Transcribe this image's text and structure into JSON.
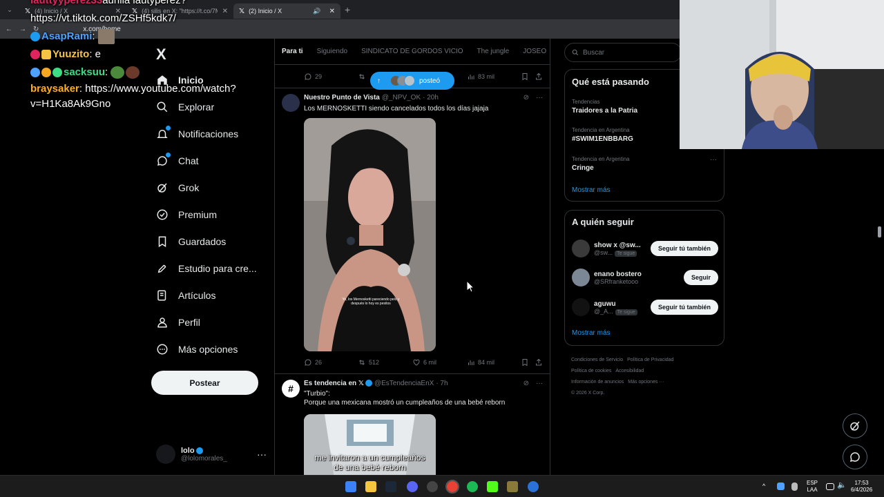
{
  "browser": {
    "tabs": [
      {
        "label": "(4) Inicio / X"
      },
      {
        "label": "(4) silis en X: \"https://t.co/7Mp"
      },
      {
        "label": "(2) Inicio / X"
      }
    ],
    "url": "x.com/home"
  },
  "chat": {
    "lines": [
      {
        "user": "lauttyyperez33",
        "text": "aurilla lautyperez?"
      },
      {
        "user": "",
        "text": "https://vt.tiktok.com/ZSHf5kdk7/"
      },
      {
        "user": "AsapRami",
        "text": ":"
      },
      {
        "user": "Yuuzito",
        "text": ": e"
      },
      {
        "user": "sacksuu",
        "text": ":"
      },
      {
        "user": "braysaker",
        "text": ": https://www.youtube.com/watch?v=H1Ka8Ak9Gno"
      }
    ]
  },
  "nav": {
    "logo": "X",
    "items": [
      {
        "label": "Inicio"
      },
      {
        "label": "Explorar"
      },
      {
        "label": "Notificaciones"
      },
      {
        "label": "Chat"
      },
      {
        "label": "Grok"
      },
      {
        "label": "Premium"
      },
      {
        "label": "Guardados"
      },
      {
        "label": "Estudio para cre..."
      },
      {
        "label": "Artículos"
      },
      {
        "label": "Perfil"
      },
      {
        "label": "Más opciones"
      }
    ],
    "post_button": "Postear",
    "account": {
      "name": "lolo",
      "handle": "@lolomorales_"
    }
  },
  "timeline": {
    "tabs": [
      "Para ti",
      "Siguiendo",
      "SINDICATO DE GORDOS VICIO",
      "The jungle",
      "JOSEO"
    ],
    "top_actions": {
      "replies": "29",
      "views": "83 mil"
    },
    "posted_pill": "posteó",
    "posts": [
      {
        "name": "Nuestro Punto de Vista",
        "handle": "@_NPV_OK",
        "time": "· 20h",
        "text": "Los MERNOSKETTI siendo cancelados todos los días jajaja",
        "media_caption": "Yo, los Mernosketti pareciendo pelo y después lo hoy es pesitos",
        "replies": "26",
        "reposts": "512",
        "likes": "6 mil",
        "views": "84 mil"
      },
      {
        "name": "Es tendencia en 𝕏",
        "handle": "@EsTendenciaEnX",
        "time": "· 7h",
        "text_line1": "\"Turbio\":",
        "text_line2": "Porque una mexicana mostró un cumpleaños de una bebé reborn",
        "media_caption_line1": "me invitaron a un cumpleaños",
        "media_caption_line2": "de una bebé reborn"
      }
    ]
  },
  "sidebar": {
    "search_placeholder": "Buscar",
    "trends_title": "Qué está pasando",
    "trends": [
      {
        "context": "Tendencias",
        "topic": "Traidores a la Patria"
      },
      {
        "context": "Tendencia en Argentina",
        "topic": "#SWIM1ENBBARG"
      },
      {
        "context": "Tendencia en Argentina",
        "topic": "Cringe"
      }
    ],
    "show_more": "Mostrar más",
    "follow_title": "A quién seguir",
    "follow": [
      {
        "name": "show x @sw...",
        "handle": "@sw...",
        "badge": "Te sigue",
        "button": "Seguir tú también"
      },
      {
        "name": "enano bostero",
        "handle": "@SRfranketooo",
        "badge": "",
        "button": "Seguir"
      },
      {
        "name": "aguwu",
        "handle": "@_A...",
        "badge": "Te sigue",
        "button": "Seguir tú también"
      }
    ],
    "follow_show_more": "Mostrar más",
    "footer": {
      "line1": [
        "Condiciones de Servicio",
        "Política de Privacidad"
      ],
      "line2": [
        "Política de cookies",
        "Accesibilidad"
      ],
      "line3": [
        "Información de anuncios",
        "Más opciones ···"
      ],
      "line4": "© 2026 X Corp."
    }
  },
  "taskbar": {
    "lang": "ESP",
    "lang2": "LAA",
    "time": "17:53",
    "date": "6/4/2026"
  },
  "colors": {
    "accent": "#1d9bf0",
    "bg": "#000000",
    "text": "#e7e9ea",
    "muted": "#71767b",
    "border": "#2f3336"
  }
}
